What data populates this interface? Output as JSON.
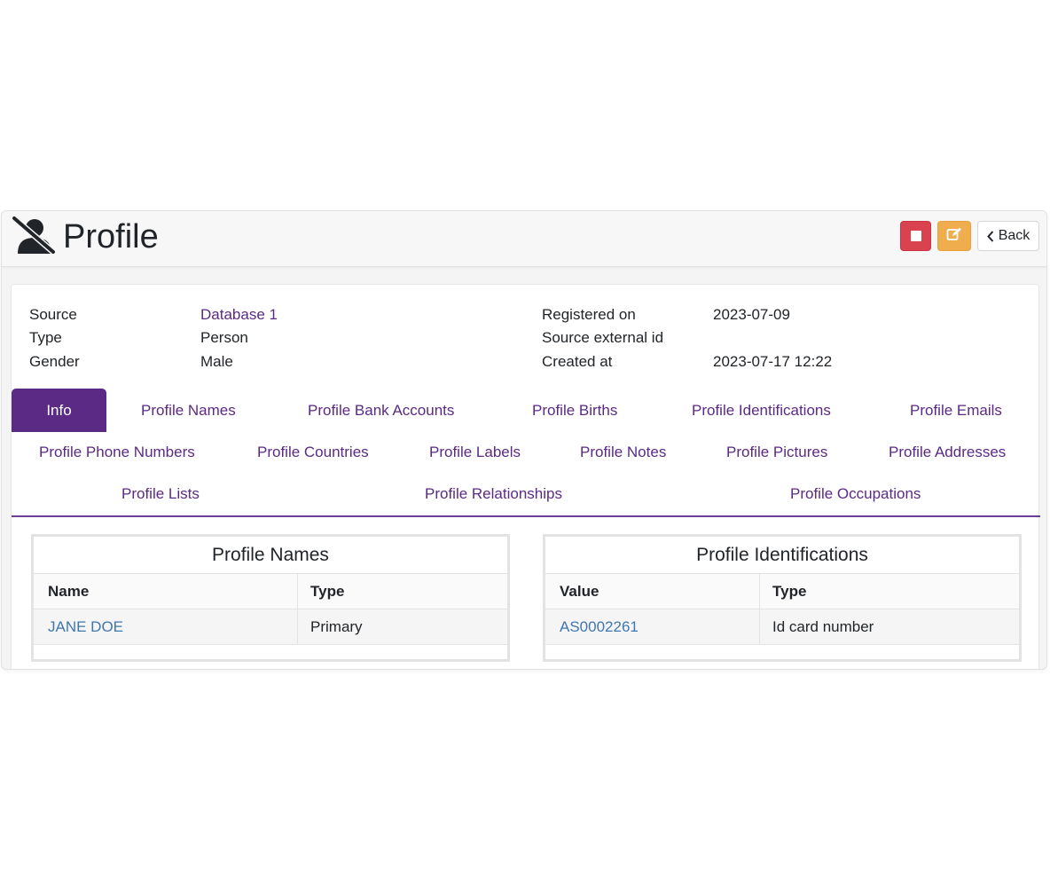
{
  "header": {
    "title": "Profile",
    "icon": "user-slash-icon",
    "back_label": "Back",
    "stop_icon": "stop-icon",
    "edit_icon": "edit-icon",
    "colors": {
      "stop": "#d9434f",
      "edit": "#f0ad4e",
      "accent": "#5b2a84"
    }
  },
  "info": {
    "left": [
      {
        "label": "Source",
        "value": "Database 1"
      },
      {
        "label": "Type",
        "value": "Person"
      },
      {
        "label": "Gender",
        "value": "Male"
      }
    ],
    "right": [
      {
        "label": "Registered on",
        "value": "2023-07-09"
      },
      {
        "label": "Source external id",
        "value": ""
      },
      {
        "label": "Created at",
        "value": "2023-07-17 12:22"
      }
    ]
  },
  "tabs": [
    "Info",
    "Profile Names",
    "Profile Bank Accounts",
    "Profile Births",
    "Profile Identifications",
    "Profile Emails",
    "Profile Phone Numbers",
    "Profile Countries",
    "Profile Labels",
    "Profile Notes",
    "Profile Pictures",
    "Profile Addresses",
    "Profile Lists",
    "Profile Relationships",
    "Profile Occupations"
  ],
  "active_tab": "Info",
  "names_panel": {
    "title": "Profile Names",
    "columns": [
      "Name",
      "Type"
    ],
    "rows": [
      [
        "JANE DOE",
        "Primary"
      ]
    ]
  },
  "ids_panel": {
    "title": "Profile Identifications",
    "columns": [
      "Value",
      "Type"
    ],
    "rows": [
      [
        "AS0002261",
        "Id card number"
      ]
    ]
  }
}
